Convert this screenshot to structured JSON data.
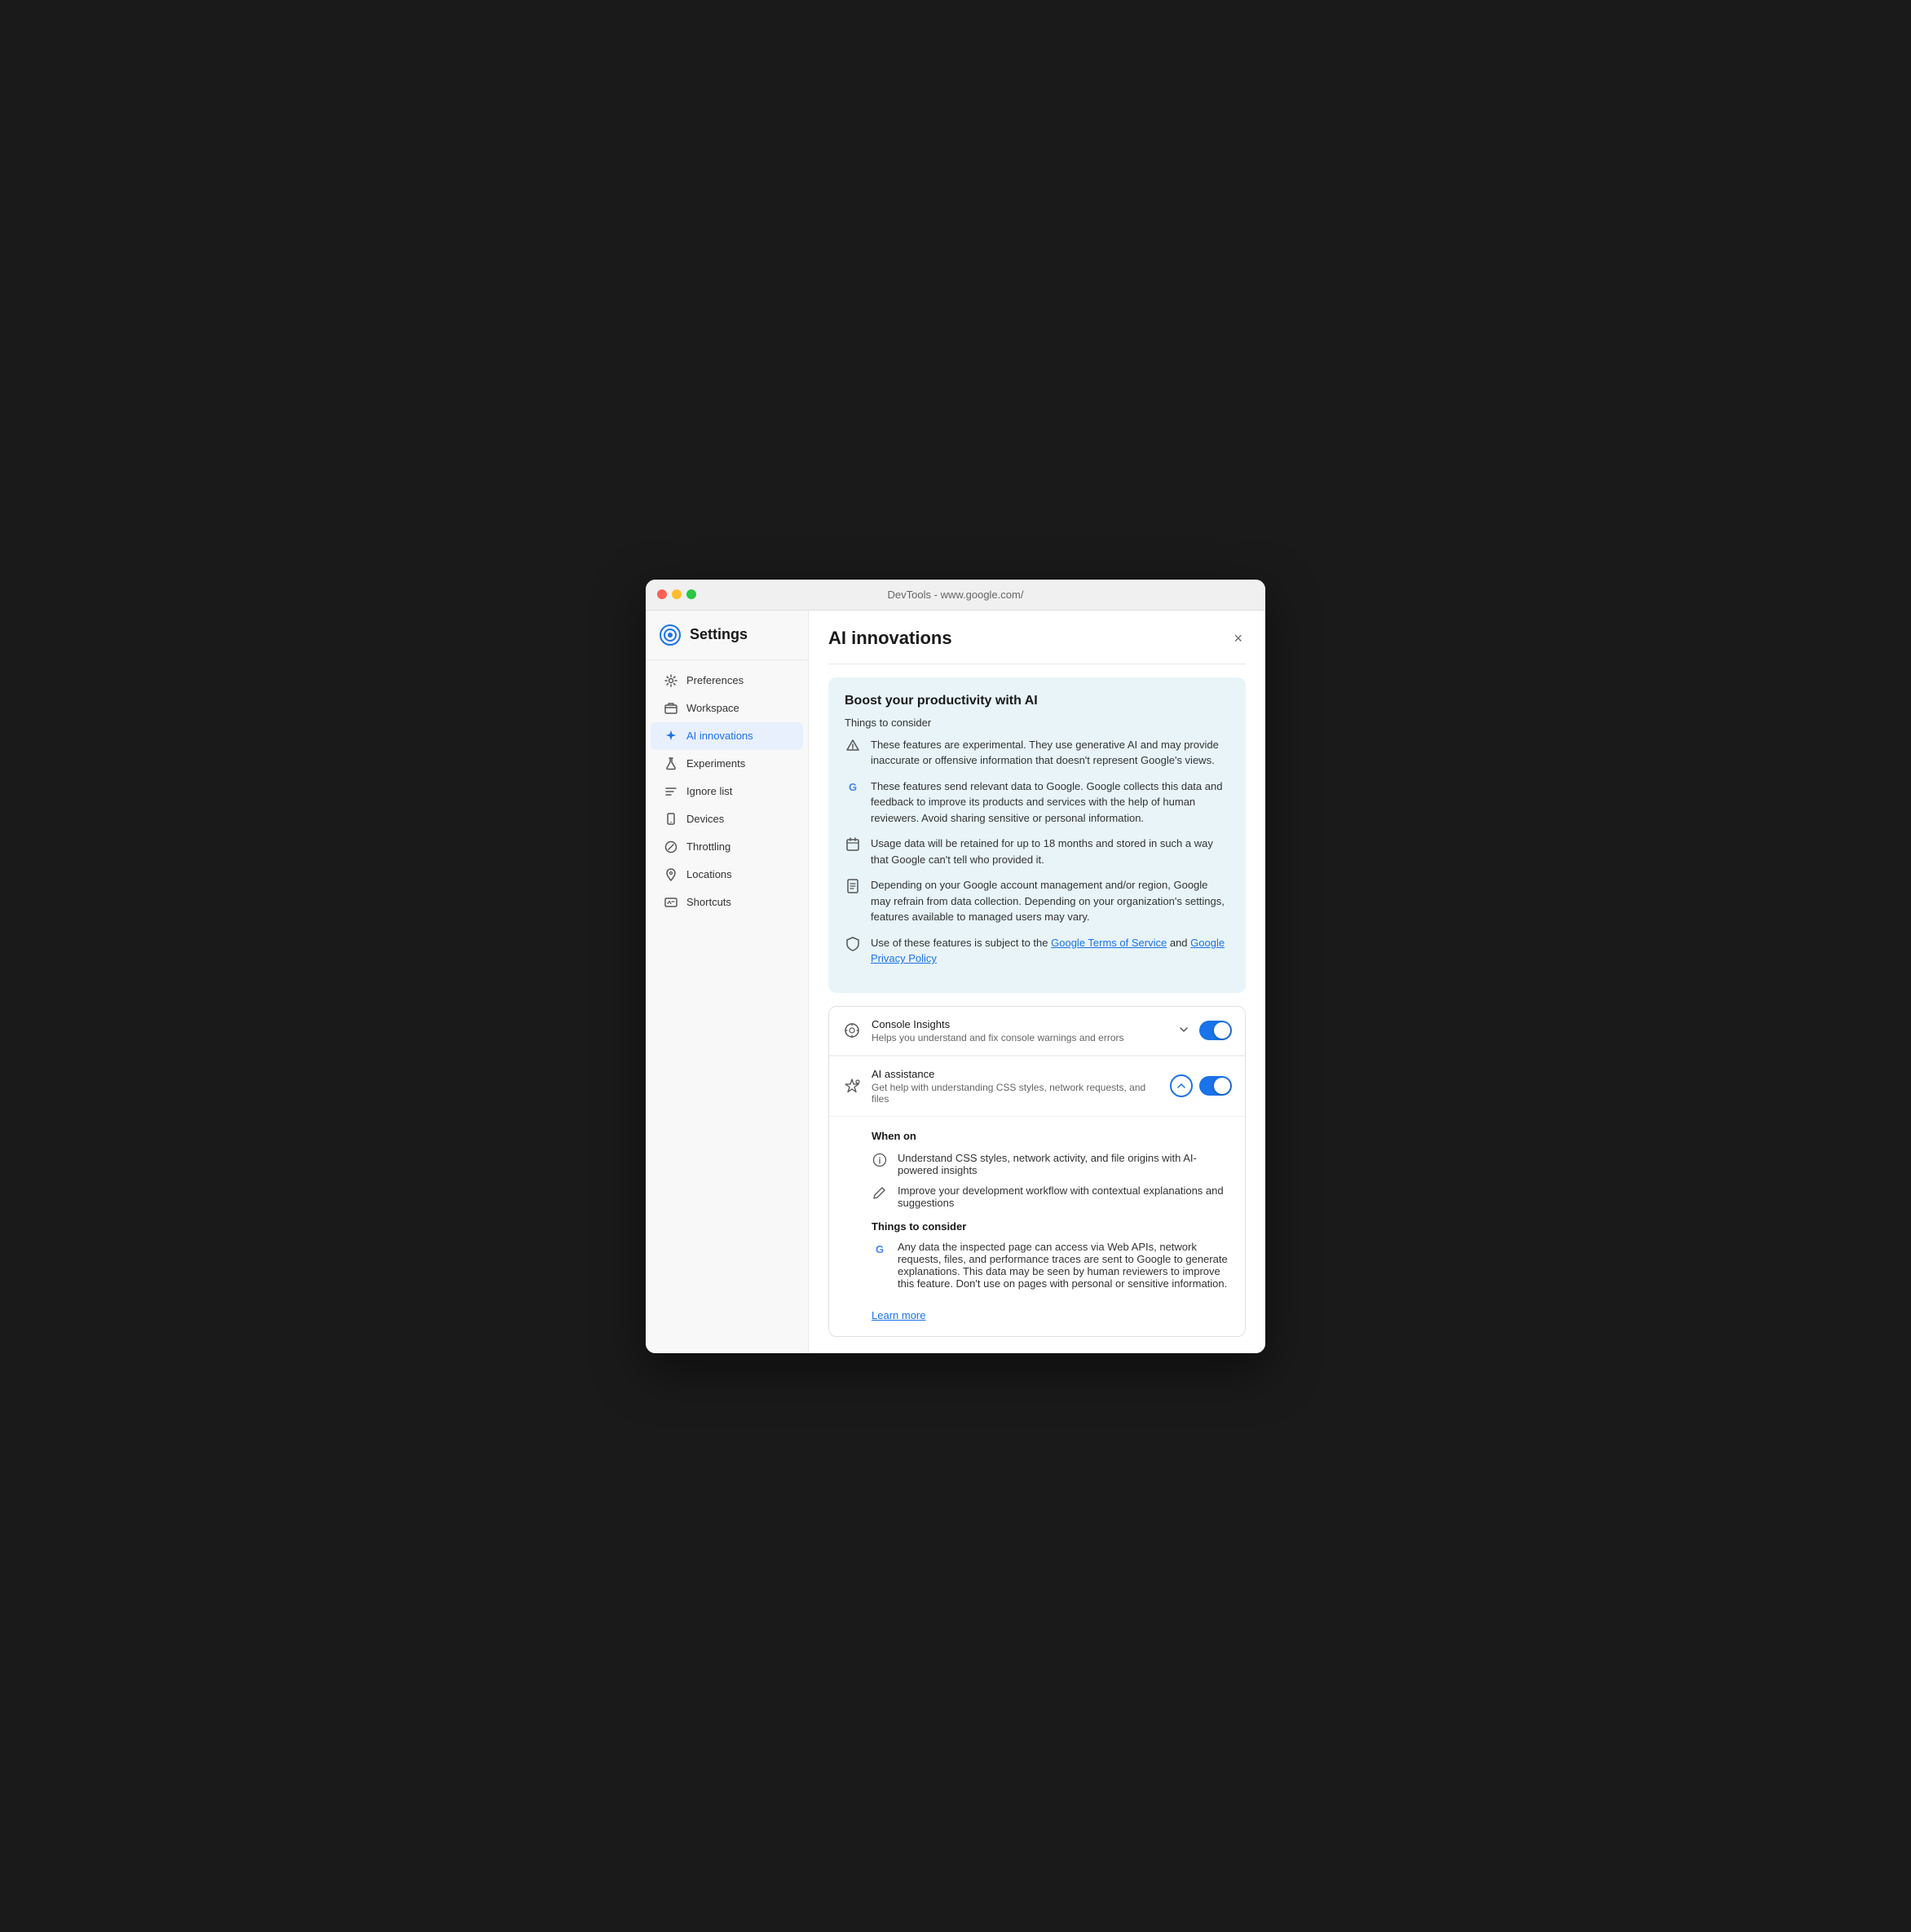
{
  "window": {
    "title": "DevTools - www.google.com/"
  },
  "sidebar": {
    "title": "Settings",
    "items": [
      {
        "id": "preferences",
        "label": "Preferences",
        "icon": "⚙"
      },
      {
        "id": "workspace",
        "label": "Workspace",
        "icon": "📁"
      },
      {
        "id": "ai-innovations",
        "label": "AI innovations",
        "icon": "✦",
        "active": true
      },
      {
        "id": "experiments",
        "label": "Experiments",
        "icon": "🧪"
      },
      {
        "id": "ignore-list",
        "label": "Ignore list",
        "icon": "≡"
      },
      {
        "id": "devices",
        "label": "Devices",
        "icon": "📱"
      },
      {
        "id": "throttling",
        "label": "Throttling",
        "icon": "⊘"
      },
      {
        "id": "locations",
        "label": "Locations",
        "icon": "📍"
      },
      {
        "id": "shortcuts",
        "label": "Shortcuts",
        "icon": "⌨"
      }
    ]
  },
  "main": {
    "title": "AI innovations",
    "close_label": "×",
    "info_box": {
      "title": "Boost your productivity with AI",
      "subtitle": "Things to consider",
      "items": [
        {
          "icon": "wifi_off",
          "text": "These features are experimental. They use generative AI and may provide inaccurate or offensive information that doesn't represent Google's views."
        },
        {
          "icon": "google",
          "text": "These features send relevant data to Google. Google collects this data and feedback to improve its products and services with the help of human reviewers. Avoid sharing sensitive or personal information."
        },
        {
          "icon": "calendar",
          "text": "Usage data will be retained for up to 18 months and stored in such a way that Google can't tell who provided it."
        },
        {
          "icon": "document",
          "text": "Depending on your Google account management and/or region, Google may refrain from data collection. Depending on your organization's settings, features available to managed users may vary."
        },
        {
          "icon": "shield",
          "text_before": "Use of these features is subject to the ",
          "link1": "Google Terms of Service",
          "text_middle": " and ",
          "link2": "Google Privacy Policy"
        }
      ]
    },
    "cards": [
      {
        "id": "console-insights",
        "icon": "💡",
        "title": "Console Insights",
        "description": "Helps you understand and fix console warnings and errors",
        "toggle": true,
        "expanded": false,
        "chevron": "down"
      },
      {
        "id": "ai-assistance",
        "icon": "✦",
        "title": "AI assistance",
        "description": "Get help with understanding CSS styles, network requests, and files",
        "toggle": true,
        "expanded": true,
        "chevron": "up"
      }
    ],
    "expanded_content": {
      "when_on_title": "When on",
      "when_on_items": [
        {
          "icon": "ℹ",
          "text": "Understand CSS styles, network activity, and file origins with AI-powered insights"
        },
        {
          "icon": "✏",
          "text": "Improve your development workflow with contextual explanations and suggestions"
        }
      ],
      "things_title": "Things to consider",
      "things_item": {
        "icon": "google",
        "text": "Any data the inspected page can access via Web APIs, network requests, files, and performance traces are sent to Google to generate explanations. This data may be seen by human reviewers to improve this feature. Don't use on pages with personal or sensitive information."
      },
      "learn_more": "Learn more"
    }
  }
}
